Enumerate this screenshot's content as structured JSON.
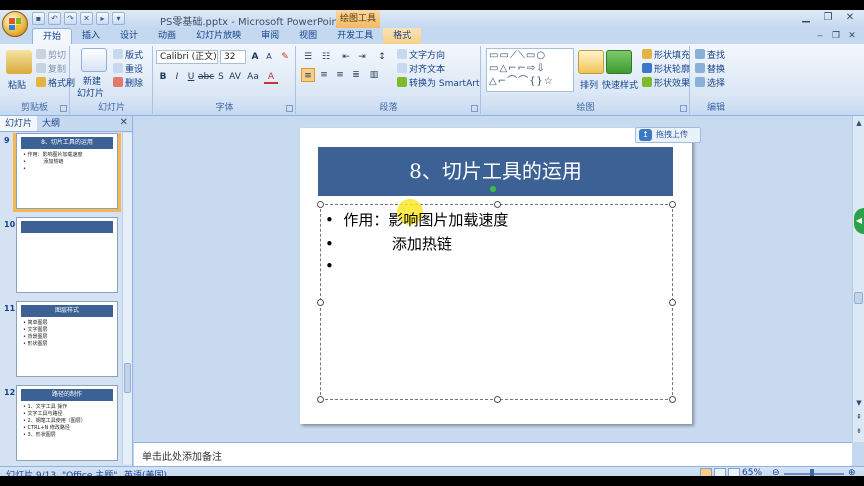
{
  "window": {
    "title": "PS零基础.pptx - Microsoft PowerPoint",
    "context_tab_title": "绘图工具"
  },
  "tabs": [
    "开始",
    "插入",
    "设计",
    "动画",
    "幻灯片放映",
    "审阅",
    "视图",
    "开发工具",
    "格式"
  ],
  "ribbon": {
    "clipboard": {
      "label": "剪贴板",
      "paste": "粘贴",
      "cut": "剪切",
      "copy": "复制",
      "format_painter": "格式刷"
    },
    "slides": {
      "label": "幻灯片",
      "new_slide_1": "新建",
      "new_slide_2": "幻灯片",
      "layout": "版式",
      "reset": "重设",
      "delete": "删除"
    },
    "font": {
      "label": "字体",
      "font_name": "Calibri (正文)",
      "font_size": "32"
    },
    "paragraph": {
      "label": "段落",
      "text_direction": "文字方向",
      "align_text": "对齐文本",
      "convert_smartart": "转换为 SmartArt"
    },
    "drawing": {
      "label": "绘图",
      "arrange": "排列",
      "quick_styles": "快速样式",
      "shape_fill": "形状填充",
      "shape_outline": "形状轮廓",
      "shape_effects": "形状效果"
    },
    "editing": {
      "label": "编辑",
      "find": "查找",
      "replace": "替换",
      "select": "选择"
    }
  },
  "panel": {
    "tab_slides": "幻灯片",
    "tab_outline": "大纲",
    "thumbnails": [
      {
        "num": "9",
        "title": "8、切片工具的运用",
        "lines": [
          "• 作用：影响图片加载速度",
          "•           添加热链",
          "•"
        ]
      },
      {
        "num": "10",
        "title": "",
        "lines": []
      },
      {
        "num": "11",
        "title": "图层样式",
        "lines": [
          "• 简单图层",
          "• 文字图层",
          "• 背景图层",
          "• 形状图层"
        ]
      },
      {
        "num": "12",
        "title": "路径的制作",
        "lines": [
          "• 1、文字工具  操作",
          "•   文字工具与路径",
          "• 2、钢笔工具使用（图层）",
          "• CTRL+N  修改路径",
          "• 3、形状图层"
        ]
      }
    ]
  },
  "slide": {
    "title": "8、切片工具的运用",
    "bullets": [
      "作用：影响图片加载速度",
      "添加热链",
      ""
    ],
    "upload_badge": "拖拽上传"
  },
  "notes_placeholder": "单击此处添加备注",
  "status": {
    "slide_pos": "幻灯片 9/13",
    "theme": "\"Office 主题\"",
    "language": "英语(美国)",
    "zoom": "65%"
  },
  "colors": {
    "title_bar": "#3c6195",
    "ribbon_accent": "#15428b",
    "selected_thumb": "#f6b754"
  }
}
